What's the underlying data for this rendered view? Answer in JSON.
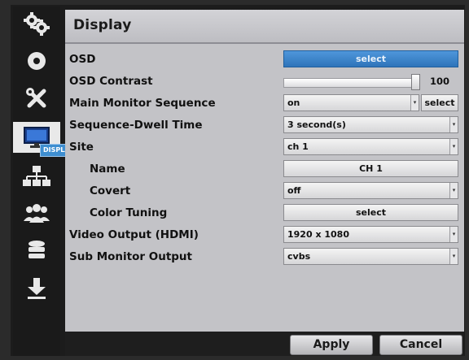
{
  "window": {
    "title": "Display"
  },
  "sidebar": {
    "items": [
      {
        "icon": "gears-icon"
      },
      {
        "icon": "disc-icon"
      },
      {
        "icon": "tools-icon"
      },
      {
        "icon": "monitor-icon",
        "active": true,
        "tooltip": "DISPLAY"
      },
      {
        "icon": "network-icon"
      },
      {
        "icon": "users-icon"
      },
      {
        "icon": "storage-icon"
      },
      {
        "icon": "download-icon"
      }
    ]
  },
  "settings": {
    "osd": {
      "label": "OSD",
      "button": "select"
    },
    "osd_contrast": {
      "label": "OSD Contrast",
      "value": 100,
      "max": 100
    },
    "main_monitor_sequence": {
      "label": "Main Monitor Sequence",
      "value": "on",
      "button": "select"
    },
    "sequence_dwell_time": {
      "label": "Sequence-Dwell Time",
      "value": "3 second(s)"
    },
    "site": {
      "label": "Site",
      "value": "ch 1"
    },
    "name": {
      "label": "Name",
      "value": "CH 1"
    },
    "covert": {
      "label": "Covert",
      "value": "off"
    },
    "color_tuning": {
      "label": "Color Tuning",
      "button": "select"
    },
    "video_output_hdmi": {
      "label": "Video Output (HDMI)",
      "value": "1920 x 1080"
    },
    "sub_monitor_output": {
      "label": "Sub Monitor Output",
      "value": "cvbs"
    }
  },
  "footer": {
    "apply": "Apply",
    "cancel": "Cancel"
  },
  "colors": {
    "accent": "#3e8ed0",
    "panel": "#c3c3c7",
    "sidebar": "#1a1a1a"
  }
}
